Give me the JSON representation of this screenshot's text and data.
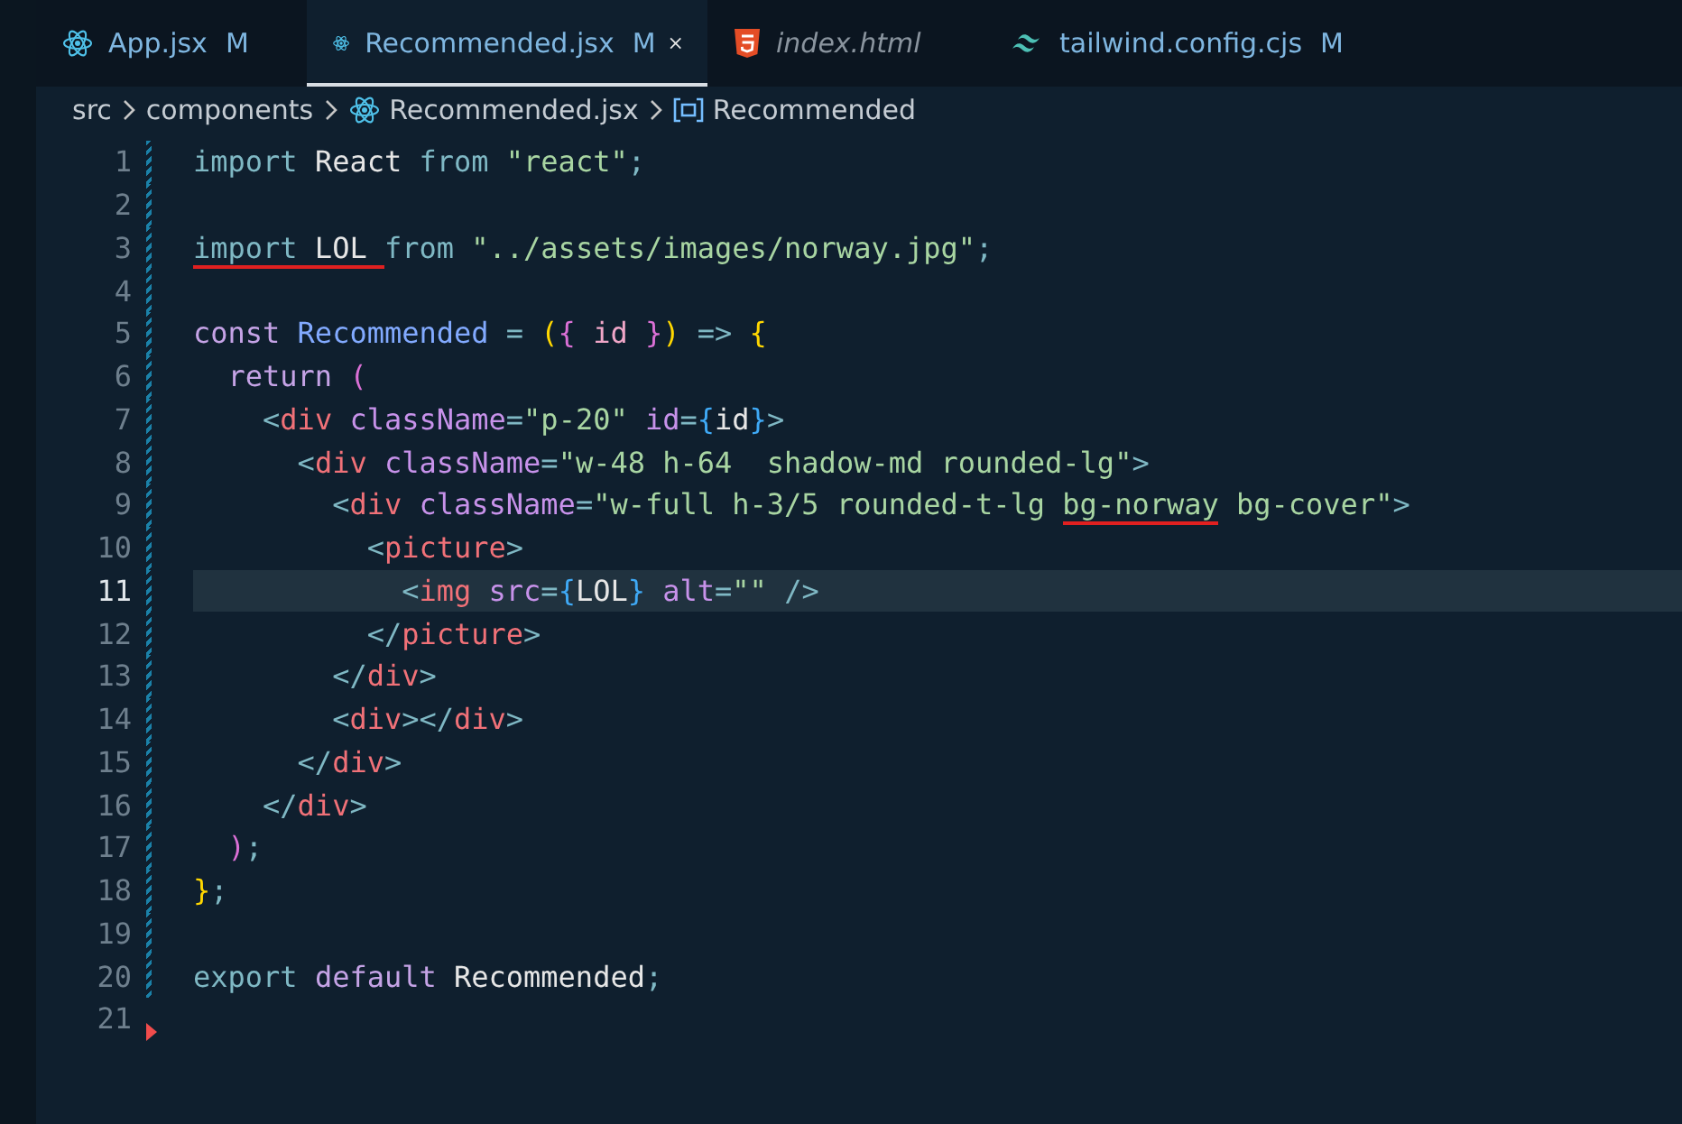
{
  "tabs": [
    {
      "label": "App.jsx",
      "status": "M",
      "selected": false,
      "preview": false
    },
    {
      "label": "Recommended.jsx",
      "status": "M",
      "selected": true,
      "preview": false
    },
    {
      "label": "index.html",
      "selected": false,
      "preview": true
    },
    {
      "label": "tailwind.config.cjs",
      "status": "M",
      "selected": false,
      "preview": false
    }
  ],
  "breadcrumbs": [
    {
      "label": "src"
    },
    {
      "label": "components"
    },
    {
      "label": "Recommended.jsx"
    },
    {
      "label": "Recommended"
    }
  ],
  "lines": [
    {
      "number": "1",
      "kind": "modified",
      "current": false,
      "tokens": [
        {
          "text": "import ",
          "kind": "kw",
          "underlined": false
        },
        {
          "text": "React ",
          "kind": "id",
          "underlined": false
        },
        {
          "text": "from ",
          "kind": "kw",
          "underlined": false
        },
        {
          "text": "\"react\"",
          "kind": "str",
          "underlined": false
        },
        {
          "text": ";",
          "kind": "op",
          "underlined": false
        }
      ]
    },
    {
      "number": "2",
      "kind": "modified",
      "current": false
    },
    {
      "number": "3",
      "kind": "modified",
      "current": false,
      "tokens": [
        {
          "text": "import",
          "kind": "kw",
          "underlined": true
        },
        {
          "text": " LOL ",
          "kind": "id",
          "underlined": true
        },
        {
          "text": "from ",
          "kind": "kw",
          "underlined": false
        },
        {
          "text": "\"../assets/images/norway.jpg\"",
          "kind": "str",
          "underlined": false
        },
        {
          "text": ";",
          "kind": "op",
          "underlined": false
        }
      ]
    },
    {
      "number": "4",
      "kind": "modified",
      "current": false
    },
    {
      "number": "5",
      "kind": "modified",
      "current": false,
      "tokens": [
        {
          "text": "const ",
          "kind": "decl",
          "underlined": false
        },
        {
          "text": "Recommended ",
          "kind": "fn",
          "underlined": false
        },
        {
          "text": "= ",
          "kind": "op",
          "underlined": false
        },
        {
          "text": "(",
          "kind": "b1",
          "underlined": false
        },
        {
          "text": "{ ",
          "kind": "b2",
          "underlined": false
        },
        {
          "text": "id ",
          "kind": "var",
          "underlined": false
        },
        {
          "text": "}",
          "kind": "b2",
          "underlined": false
        },
        {
          "text": ") ",
          "kind": "b1",
          "underlined": false
        },
        {
          "text": "=> ",
          "kind": "op",
          "underlined": false
        },
        {
          "text": "{",
          "kind": "b1",
          "underlined": false
        }
      ]
    },
    {
      "number": "6",
      "kind": "modified",
      "current": false,
      "tokens": [
        {
          "text": "  return ",
          "kind": "decl",
          "underlined": false
        },
        {
          "text": "(",
          "kind": "b2",
          "underlined": false
        }
      ]
    },
    {
      "number": "7",
      "kind": "modified",
      "current": false,
      "tokens": [
        {
          "text": "    <",
          "kind": "op",
          "underlined": false
        },
        {
          "text": "div ",
          "kind": "tag",
          "underlined": false
        },
        {
          "text": "className",
          "kind": "attr",
          "underlined": false
        },
        {
          "text": "=",
          "kind": "op",
          "underlined": false
        },
        {
          "text": "\"p-20\" ",
          "kind": "str",
          "underlined": false
        },
        {
          "text": "id",
          "kind": "attr",
          "underlined": false
        },
        {
          "text": "=",
          "kind": "op",
          "underlined": false
        },
        {
          "text": "{",
          "kind": "b3",
          "underlined": false
        },
        {
          "text": "id",
          "kind": "id",
          "underlined": false
        },
        {
          "text": "}",
          "kind": "b3",
          "underlined": false
        },
        {
          "text": ">",
          "kind": "op",
          "underlined": false
        }
      ]
    },
    {
      "number": "8",
      "kind": "modified",
      "current": false,
      "tokens": [
        {
          "text": "      <",
          "kind": "op",
          "underlined": false
        },
        {
          "text": "div ",
          "kind": "tag",
          "underlined": false
        },
        {
          "text": "className",
          "kind": "attr",
          "underlined": false
        },
        {
          "text": "=",
          "kind": "op",
          "underlined": false
        },
        {
          "text": "\"w-48 h-64  shadow-md rounded-lg\"",
          "kind": "str",
          "underlined": false
        },
        {
          "text": ">",
          "kind": "op",
          "underlined": false
        }
      ]
    },
    {
      "number": "9",
      "kind": "modified",
      "current": false,
      "tokens": [
        {
          "text": "        <",
          "kind": "op",
          "underlined": false
        },
        {
          "text": "div ",
          "kind": "tag",
          "underlined": false
        },
        {
          "text": "className",
          "kind": "attr",
          "underlined": false
        },
        {
          "text": "=",
          "kind": "op",
          "underlined": false
        },
        {
          "text": "\"w-full h-3/5 rounded-t-lg ",
          "kind": "str",
          "underlined": false
        },
        {
          "text": "bg-norway",
          "kind": "str",
          "underlined": true
        },
        {
          "text": " bg-cover\"",
          "kind": "str",
          "underlined": false
        },
        {
          "text": ">",
          "kind": "op",
          "underlined": false
        }
      ]
    },
    {
      "number": "10",
      "kind": "modified",
      "current": false,
      "tokens": [
        {
          "text": "          <",
          "kind": "op",
          "underlined": false
        },
        {
          "text": "picture",
          "kind": "tag",
          "underlined": false
        },
        {
          "text": ">",
          "kind": "op",
          "underlined": false
        }
      ]
    },
    {
      "number": "11",
      "kind": "modified",
      "current": true,
      "tokens": [
        {
          "text": "            <",
          "kind": "op",
          "underlined": false
        },
        {
          "text": "img ",
          "kind": "tag",
          "underlined": false
        },
        {
          "text": "src",
          "kind": "attr",
          "underlined": false
        },
        {
          "text": "=",
          "kind": "op",
          "underlined": false
        },
        {
          "text": "{",
          "kind": "b3",
          "underlined": false
        },
        {
          "text": "LOL",
          "kind": "id",
          "underlined": false
        },
        {
          "text": "} ",
          "kind": "b3",
          "underlined": false
        },
        {
          "text": "alt",
          "kind": "attr",
          "underlined": false
        },
        {
          "text": "=",
          "kind": "op",
          "underlined": false
        },
        {
          "text": "\"\" ",
          "kind": "str",
          "underlined": false
        },
        {
          "text": "/>",
          "kind": "op",
          "underlined": false
        }
      ]
    },
    {
      "number": "12",
      "kind": "modified",
      "current": false,
      "tokens": [
        {
          "text": "          </",
          "kind": "op",
          "underlined": false
        },
        {
          "text": "picture",
          "kind": "tag",
          "underlined": false
        },
        {
          "text": ">",
          "kind": "op",
          "underlined": false
        }
      ]
    },
    {
      "number": "13",
      "kind": "modified",
      "current": false,
      "tokens": [
        {
          "text": "        </",
          "kind": "op",
          "underlined": false
        },
        {
          "text": "div",
          "kind": "tag",
          "underlined": false
        },
        {
          "text": ">",
          "kind": "op",
          "underlined": false
        }
      ]
    },
    {
      "number": "14",
      "kind": "modified",
      "current": false,
      "tokens": [
        {
          "text": "        <",
          "kind": "op",
          "underlined": false
        },
        {
          "text": "div",
          "kind": "tag",
          "underlined": false
        },
        {
          "text": "></",
          "kind": "op",
          "underlined": false
        },
        {
          "text": "div",
          "kind": "tag",
          "underlined": false
        },
        {
          "text": ">",
          "kind": "op",
          "underlined": false
        }
      ]
    },
    {
      "number": "15",
      "kind": "modified",
      "current": false,
      "tokens": [
        {
          "text": "      </",
          "kind": "op",
          "underlined": false
        },
        {
          "text": "div",
          "kind": "tag",
          "underlined": false
        },
        {
          "text": ">",
          "kind": "op",
          "underlined": false
        }
      ]
    },
    {
      "number": "16",
      "kind": "modified",
      "current": false,
      "tokens": [
        {
          "text": "    </",
          "kind": "op",
          "underlined": false
        },
        {
          "text": "div",
          "kind": "tag",
          "underlined": false
        },
        {
          "text": ">",
          "kind": "op",
          "underlined": false
        }
      ]
    },
    {
      "number": "17",
      "kind": "modified",
      "current": false,
      "tokens": [
        {
          "text": "  )",
          "kind": "b2",
          "underlined": false
        },
        {
          "text": ";",
          "kind": "op",
          "underlined": false
        }
      ]
    },
    {
      "number": "18",
      "kind": "modified",
      "current": false,
      "tokens": [
        {
          "text": "}",
          "kind": "b1",
          "underlined": false
        },
        {
          "text": ";",
          "kind": "op",
          "underlined": false
        }
      ]
    },
    {
      "number": "19",
      "kind": "modified",
      "current": false
    },
    {
      "number": "20",
      "kind": "modified",
      "current": false,
      "tokens": [
        {
          "text": "export ",
          "kind": "kw",
          "underlined": false
        },
        {
          "text": "default ",
          "kind": "decl",
          "underlined": false
        },
        {
          "text": "Recommended",
          "kind": "id",
          "underlined": false
        },
        {
          "text": ";",
          "kind": "op",
          "underlined": false
        }
      ]
    },
    {
      "number": "21",
      "kind": "deleted",
      "current": false
    }
  ]
}
